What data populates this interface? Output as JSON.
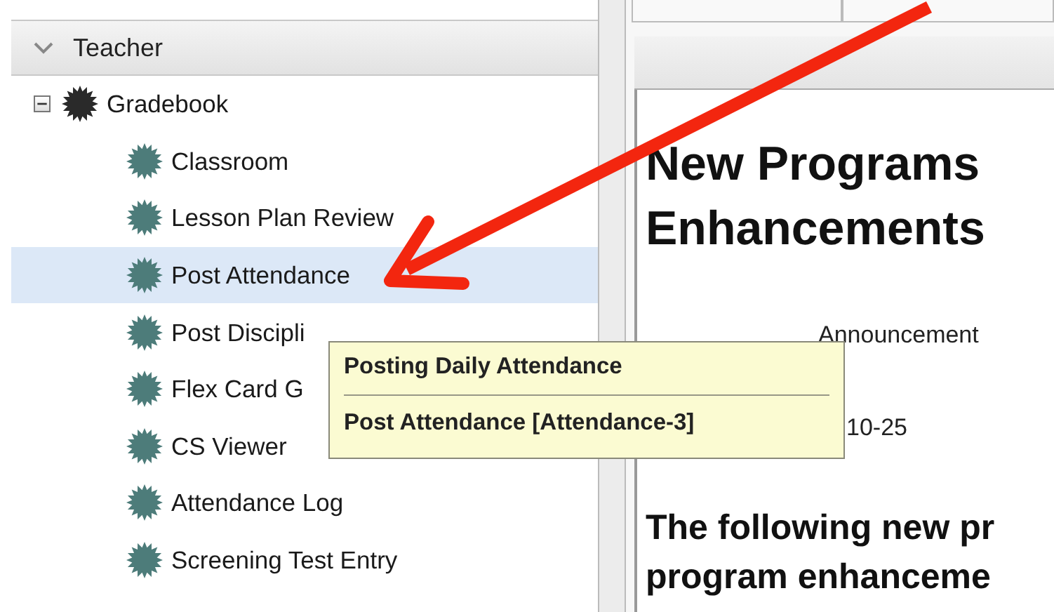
{
  "sidebar": {
    "section": {
      "label": "Teacher",
      "expanded": true
    },
    "tree": [
      {
        "label": "Gradebook",
        "expanded": true,
        "children": [
          {
            "label": "Classroom",
            "selected": false
          },
          {
            "label": "Lesson Plan Review",
            "selected": false
          },
          {
            "label": "Post Attendance",
            "selected": true
          },
          {
            "label": "Post Discipli",
            "selected": false
          },
          {
            "label": "Flex Card G",
            "selected": false
          },
          {
            "label": "CS Viewer",
            "selected": false
          },
          {
            "label": "Attendance Log",
            "selected": false
          },
          {
            "label": "Screening Test Entry",
            "selected": false
          }
        ]
      }
    ]
  },
  "content": {
    "heading_lines": [
      "New Programs",
      "Enhancements"
    ],
    "subtitle": "Announcement",
    "date": "10-25",
    "subheading_lines": [
      "The following new pr",
      "program enhanceme"
    ]
  },
  "tooltip": {
    "title": "Posting Daily Attendance",
    "detail": "Post Attendance [Attendance-3]"
  }
}
